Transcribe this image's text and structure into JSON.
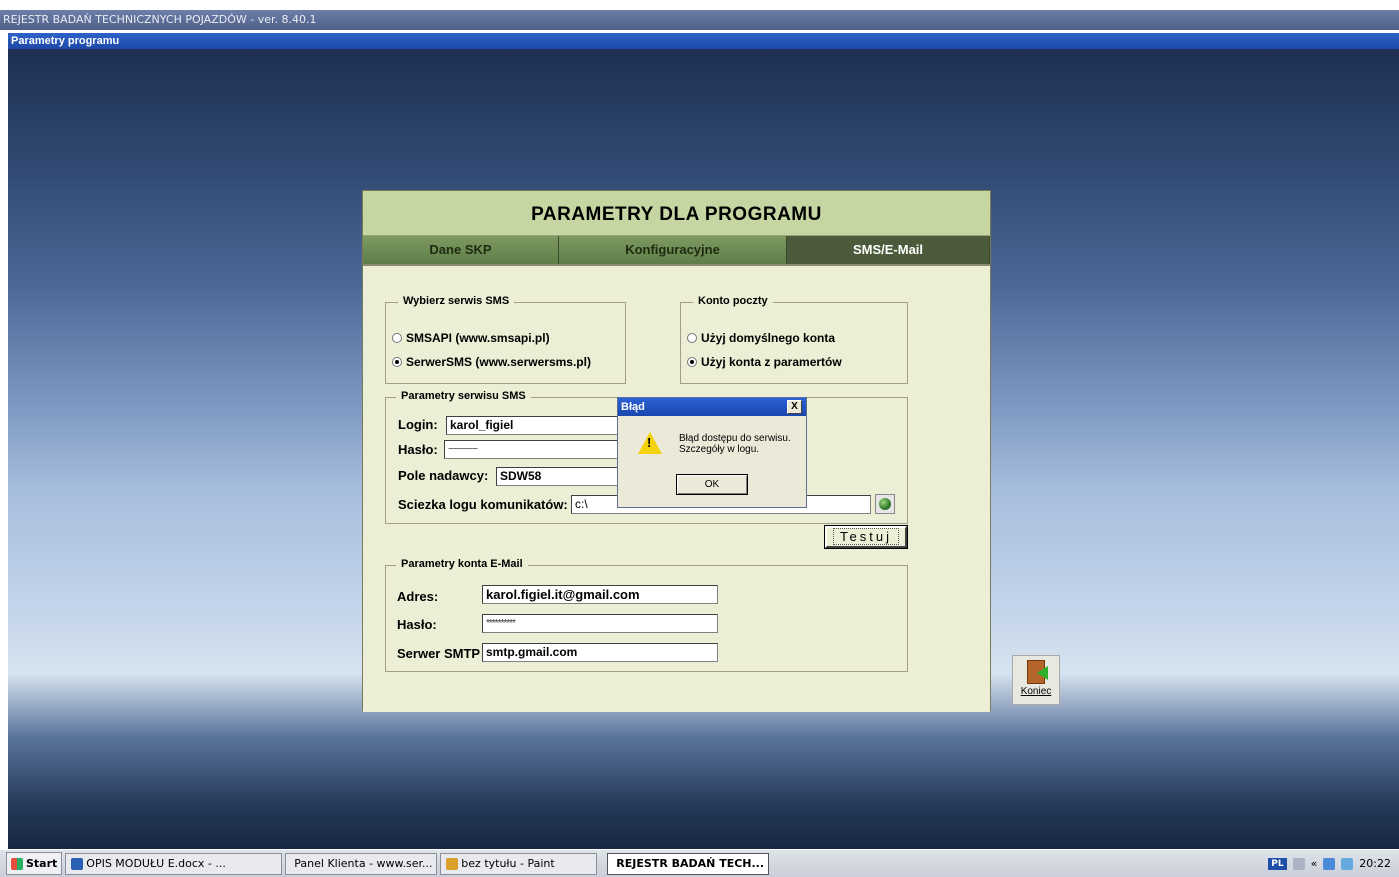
{
  "window": {
    "app_title": "REJESTR BADAŃ TECHNICZNYCH POJAZDÓW - ver. 8.40.1",
    "subwindow_title": "Parametry programu"
  },
  "panel": {
    "title": "PARAMETRY DLA PROGRAMU",
    "tabs": [
      {
        "label": "Dane SKP",
        "active": false
      },
      {
        "label": "Konfiguracyjne",
        "active": false
      },
      {
        "label": "SMS/E-Mail",
        "active": true
      }
    ]
  },
  "sms_service": {
    "legend": "Wybierz serwis SMS",
    "options": [
      {
        "label": "SMSAPI (www.smsapi.pl)",
        "selected": false
      },
      {
        "label": "SerwerSMS (www.serwersms.pl)",
        "selected": true
      }
    ]
  },
  "mail_account": {
    "legend": "Konto poczty",
    "options": [
      {
        "label": "Użyj domyślnego konta",
        "selected": false
      },
      {
        "label": "Użyj konta z paramertów",
        "selected": true
      }
    ]
  },
  "sms_params": {
    "legend": "Parametry serwisu SMS",
    "login_label": "Login:",
    "login_value": "karol_figiel",
    "password_label": "Hasło:",
    "password_value": "~~~~~~",
    "sender_label": "Pole nadawcy:",
    "sender_value": "SDW58",
    "log_path_label": "Sciezka logu komunikatów:",
    "log_path_value": "c:\\",
    "test_button": "Testuj"
  },
  "email_params": {
    "legend": "Parametry konta E-Mail",
    "address_label": "Adres:",
    "address_value": "karol.figiel.it@gmail.com",
    "password_label": "Hasło:",
    "password_value": "**********",
    "smtp_label": "Serwer SMTP",
    "smtp_value": "smtp.gmail.com"
  },
  "dialog": {
    "title": "Błąd",
    "close": "X",
    "icon_mark": "!",
    "message": "Błąd dostępu do serwisu.\nSzczegóły w logu.",
    "ok": "OK"
  },
  "koniec_label": "Koniec",
  "taskbar": {
    "start": "Start",
    "items": [
      {
        "label": "OPIS MODUŁU E.docx - ...",
        "active": false,
        "color": "#2b5fb4"
      },
      {
        "label": "Panel Klienta - www.ser...",
        "active": false,
        "color": "#3a8ad6"
      },
      {
        "label": "bez tytułu - Paint",
        "active": false,
        "color": "#d9a02a"
      },
      {
        "label": "REJESTR BADAŃ TECH...",
        "active": true,
        "color": "#c0392b"
      }
    ],
    "lang": "PL",
    "chevron": "«",
    "clock": "20:22"
  }
}
